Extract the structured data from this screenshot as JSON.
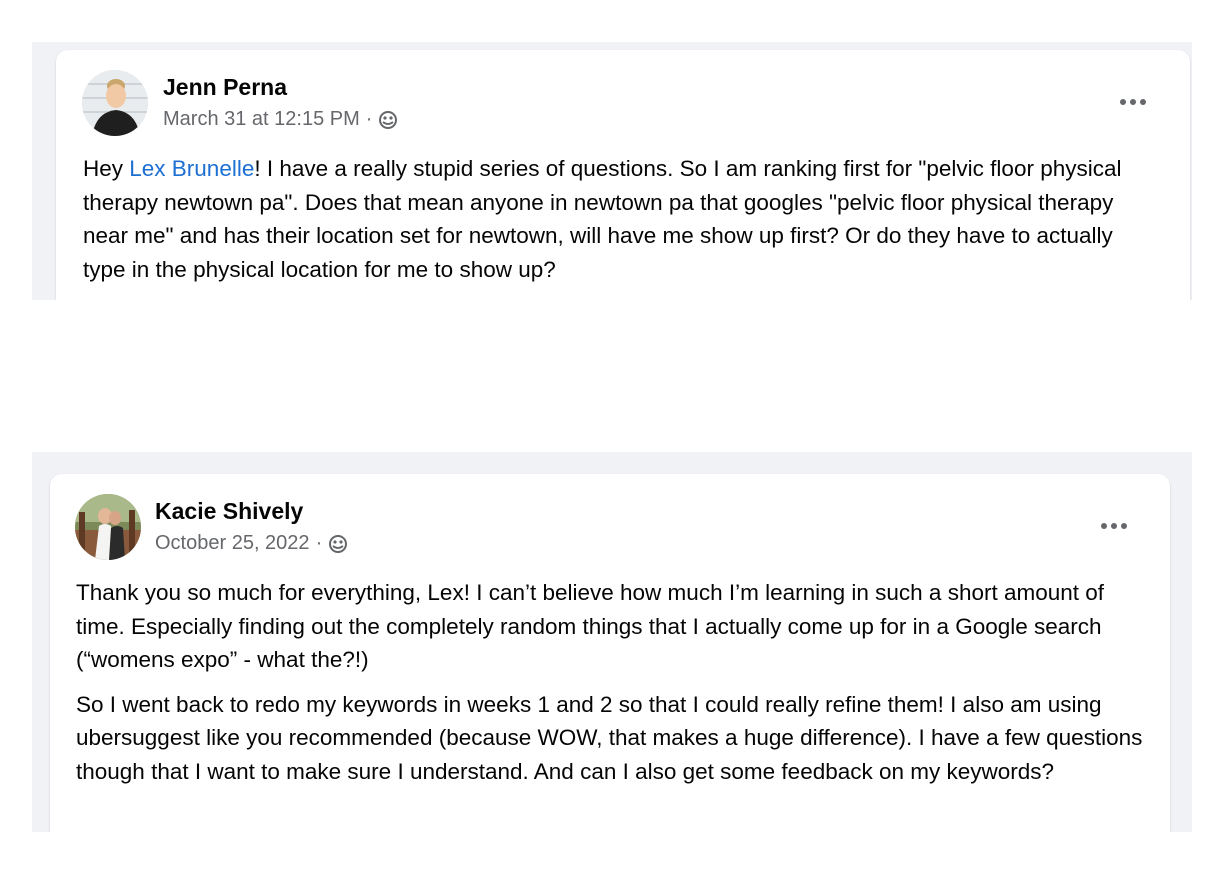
{
  "posts": [
    {
      "author": "Jenn Perna",
      "timestamp": "March 31 at 12:15 PM",
      "separator": "·",
      "audience_icon": "globe-icon",
      "more_icon": "more-horizontal-icon",
      "body": {
        "prefix": "Hey ",
        "mention": "Lex Brunelle",
        "suffix": "! I have a really stupid series of questions. So I am ranking first for \"pelvic floor physical therapy newtown pa\". Does that mean anyone in newtown pa that googles \"pelvic floor physical therapy near me\" and has their location set for newtown, will have me show up first? Or do they have to actually type in the physical location for me to show up?"
      }
    },
    {
      "author": "Kacie Shively",
      "timestamp": "October 25, 2022",
      "separator": "·",
      "audience_icon": "globe-icon",
      "more_icon": "more-horizontal-icon",
      "paragraphs": [
        "Thank you so much for everything, Lex! I can’t believe how much I’m learning in such a short amount of time. Especially finding out the completely random things that I actually come up for in a Google search (“womens expo” - what the?!)",
        "So I went back to redo my keywords in weeks 1 and 2 so that I could really refine them! I also am using ubersuggest like you recommended (because WOW, that makes a huge difference). I have a few questions though that I want to make sure I understand. And can I also get some feedback on my keywords?"
      ]
    }
  ],
  "colors": {
    "panel_bg": "#f0f2f5",
    "card_bg": "#ffffff",
    "text": "#050505",
    "secondary_text": "#65676b",
    "mention": "#1d6fd1"
  }
}
